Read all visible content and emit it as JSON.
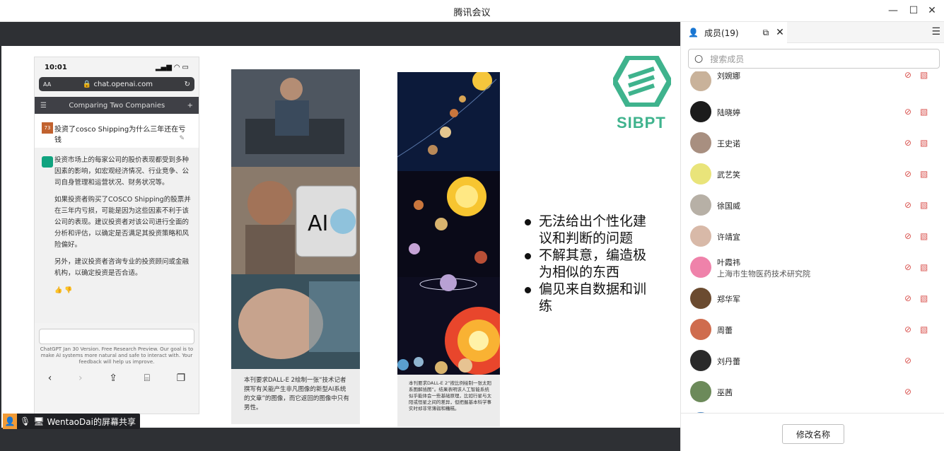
{
  "window": {
    "title": "腾讯会议"
  },
  "share": {
    "label": "WentaoDai的屏幕共享"
  },
  "phone": {
    "time": "10:01",
    "url": "chat.openai.com",
    "aa": "AA",
    "conv_title": "Comparing Two Companies",
    "q_avatar": "73",
    "question": "投资了cosco Shipping为什么三年还在亏钱",
    "answer_p1": "投资市场上的每家公司的股价表现都受到多种因素的影响，如宏观经济情况、行业竞争、公司自身管理和运营状况、财务状况等。",
    "answer_p2": "如果投资者购买了COSCO Shipping的股票并在三年内亏损，可能是因为这些因素不利于该公司的表现。建议投资者对该公司进行全面的分析和评估，以确定是否满足其投资策略和风险偏好。",
    "answer_p3": "另外，建议投资者咨询专业的投资顾问或金融机构，以确定投资是否合适。",
    "footer": "ChatGPT Jan 30 Version. Free Research Preview. Our goal is to make AI systems more natural and safe to interact with. Your feedback will help us improve."
  },
  "slide": {
    "caption1": "本刊要求DALL-E  2绘制一张“技术记者撰写有关能产生非凡图像的新型AI系统的文章”的图像，而它返回的图像中只有男性。",
    "caption2": "本刊要求DALL-E  2“按比例绘制一张太阳系图解插图”。结果表明该人工智能系统似乎能体会一些基础原理，比如行星与太阳或恒星之间的差异，但把握基本科学事实时却非常薄弱和糟糕。",
    "ai_text": "AI",
    "logo": "SIBPT",
    "bullets": [
      "无法给出个性化建议和判断的问题",
      "不解其意，编造极为相似的东西",
      "偏见来自数据和训练"
    ]
  },
  "sidebar": {
    "tab_label": "成员(19)",
    "search_placeholder": "搜索成员",
    "rename_label": "修改名称",
    "members": [
      {
        "name": "刘婉娜"
      },
      {
        "name": "陆晓婷"
      },
      {
        "name": "王史诺"
      },
      {
        "name": "武艺笑"
      },
      {
        "name": "徐国威"
      },
      {
        "name": "许靖宜"
      },
      {
        "name": "叶霞祎",
        "org": "上海市生物医药技术研究院"
      },
      {
        "name": "郑华军"
      },
      {
        "name": "周蕾"
      },
      {
        "name": "刘丹蕾"
      },
      {
        "name": "巫茜"
      }
    ]
  },
  "colors": {
    "accent_green": "#3fb38d",
    "muted_red": "#d9534f",
    "dark_band": "#2e3034"
  }
}
